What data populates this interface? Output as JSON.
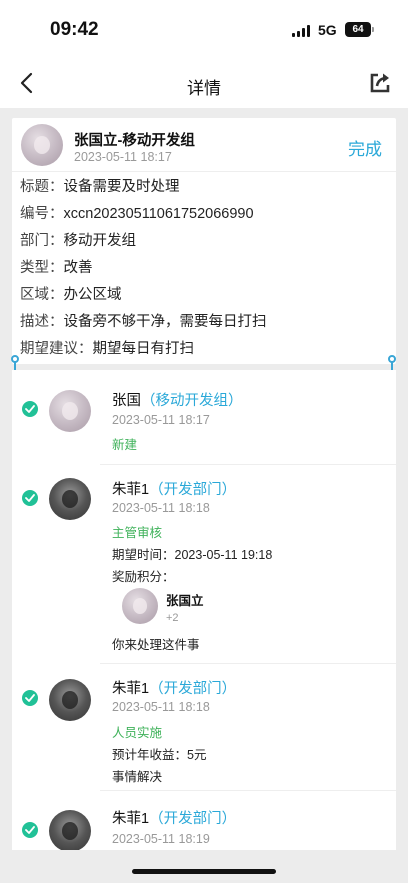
{
  "status_bar": {
    "time": "09:42",
    "network": "5G",
    "battery": "64"
  },
  "nav": {
    "title": "详情"
  },
  "detail": {
    "creator_name": "张国立-移动开发组",
    "created_time": "2023-05-11 18:17",
    "complete_label": "完成",
    "rows": [
      {
        "label": "标题：",
        "value": "设备需要及时处理"
      },
      {
        "label": "编号：",
        "value": "xccn20230511061752066990"
      },
      {
        "label": "部门：",
        "value": "移动开发组"
      },
      {
        "label": "类型：",
        "value": "改善"
      },
      {
        "label": "区域：",
        "value": "办公区域"
      },
      {
        "label": "描述：",
        "value": "设备旁不够干净，需要每日打扫"
      },
      {
        "label": "期望建议：",
        "value": "期望每日有打扫"
      }
    ]
  },
  "timeline": [
    {
      "name": "张国",
      "dept": "（移动开发组）",
      "time": "2023-05-11 18:17",
      "action": "新建"
    },
    {
      "name": "朱菲1",
      "dept": "（开发部门）",
      "time": "2023-05-11 18:18",
      "action": "主管审核",
      "expected_label": "期望时间：",
      "expected_value": "2023-05-11 19:18",
      "reward_label": "奖励积分：",
      "reward_user": "张国立",
      "reward_points": "+2",
      "note": "你来处理这件事"
    },
    {
      "name": "朱菲1",
      "dept": "（开发部门）",
      "time": "2023-05-11 18:18",
      "action": "人员实施",
      "income_label": "预计年收益：",
      "income_value": "5元",
      "note": "事情解决"
    },
    {
      "name": "朱菲1",
      "dept": "（开发部门）",
      "time": "2023-05-11 18:19"
    }
  ],
  "icons": {
    "back": "chevron-left-icon",
    "share": "share-export-icon",
    "check": "check-circle-icon"
  },
  "colors": {
    "accent": "#2aa8d8",
    "success": "#21c197",
    "action": "#3fb25a"
  }
}
